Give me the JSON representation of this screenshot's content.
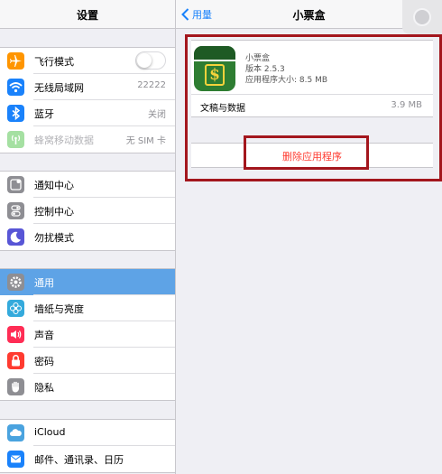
{
  "settings": {
    "title": "设置",
    "groups": [
      {
        "items": [
          {
            "label": "飞行模式",
            "icon": "airplane-icon",
            "color": "#ff9500",
            "toggle": true
          },
          {
            "label": "无线局域网",
            "icon": "wifi-icon",
            "color": "#1a82fb",
            "value": "22222"
          },
          {
            "label": "蓝牙",
            "icon": "bluetooth-icon",
            "color": "#1a82fb",
            "value": "关闭"
          },
          {
            "label": "蜂窝移动数据",
            "icon": "cellular-icon",
            "color": "#a5e0a2",
            "value": "无 SIM 卡"
          }
        ]
      },
      {
        "items": [
          {
            "label": "通知中心",
            "icon": "notification-center-icon",
            "color": "#8e8e93"
          },
          {
            "label": "控制中心",
            "icon": "control-center-icon",
            "color": "#8e8e93"
          },
          {
            "label": "勿扰模式",
            "icon": "moon-icon",
            "color": "#5856d6"
          }
        ]
      },
      {
        "items": [
          {
            "label": "通用",
            "icon": "gear-icon",
            "color": "#8e8e93",
            "selected": true
          },
          {
            "label": "墙纸与亮度",
            "icon": "wallpaper-flower-icon",
            "color": "#34aadc"
          },
          {
            "label": "声音",
            "icon": "speaker-icon",
            "color": "#ff2d55"
          },
          {
            "label": "密码",
            "icon": "lock-icon",
            "color": "#ff3b30"
          },
          {
            "label": "隐私",
            "icon": "hand-icon",
            "color": "#8e8e93"
          }
        ]
      },
      {
        "items": [
          {
            "label": "iCloud",
            "icon": "cloud-icon",
            "color": "#4aa3df"
          },
          {
            "label": "邮件、通讯录、日历",
            "icon": "mail-icon",
            "color": "#1a82fb"
          }
        ]
      }
    ]
  },
  "detail": {
    "back_label": "用量",
    "title": "小票盒",
    "app": {
      "name": "小票盒",
      "version": "版本 2.5.3",
      "size": "应用程序大小:   8.5 MB",
      "icon_text": "$"
    },
    "documents": {
      "label": "文稿与数据",
      "value": "3.9 MB"
    },
    "delete_label": "删除应用程序"
  },
  "colors": {
    "accent": "#1a82fb",
    "selected_row": "#5ea3e6",
    "delete_text": "#ff3b30",
    "annotation_box": "#a3161d"
  }
}
